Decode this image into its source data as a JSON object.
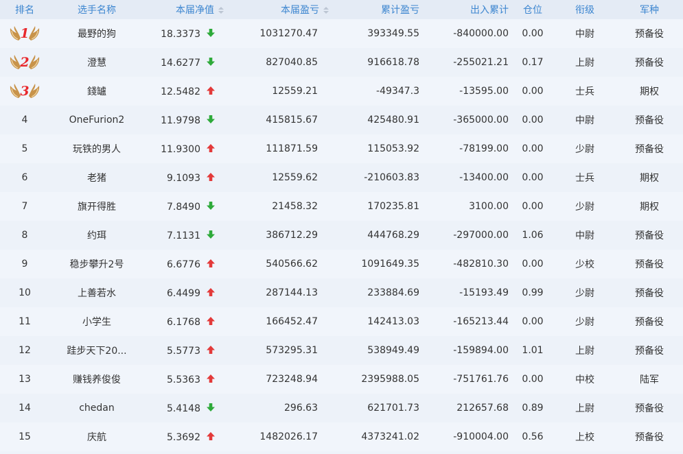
{
  "headers": {
    "rank": "排名",
    "name": "选手名称",
    "nav": "本届净值",
    "profit": "本届盈亏",
    "total": "累计盈亏",
    "flow": "出入累计",
    "position": "仓位",
    "title": "衔级",
    "branch": "军种"
  },
  "colors": {
    "header_text": "#3d86d0",
    "up": "#e33a3a",
    "down": "#2eaa3a",
    "medal_number": "#e8282c"
  },
  "rows": [
    {
      "rank": "1",
      "name": "最野的狗",
      "nav": "18.3373",
      "trend": "down",
      "profit": "1031270.47",
      "total": "393349.55",
      "flow": "-840000.00",
      "pos": "0.00",
      "title": "中尉",
      "branch": "预备役"
    },
    {
      "rank": "2",
      "name": "澄慧",
      "nav": "14.6277",
      "trend": "down",
      "profit": "827040.85",
      "total": "916618.78",
      "flow": "-255021.21",
      "pos": "0.17",
      "title": "上尉",
      "branch": "预备役"
    },
    {
      "rank": "3",
      "name": "錢罏",
      "nav": "12.5482",
      "trend": "up",
      "profit": "12559.21",
      "total": "-49347.3",
      "flow": "-13595.00",
      "pos": "0.00",
      "title": "士兵",
      "branch": "期权"
    },
    {
      "rank": "4",
      "name": "OneFurion2",
      "nav": "11.9798",
      "trend": "down",
      "profit": "415815.67",
      "total": "425480.91",
      "flow": "-365000.00",
      "pos": "0.00",
      "title": "中尉",
      "branch": "预备役"
    },
    {
      "rank": "5",
      "name": "玩铁的男人",
      "nav": "11.9300",
      "trend": "up",
      "profit": "111871.59",
      "total": "115053.92",
      "flow": "-78199.00",
      "pos": "0.00",
      "title": "少尉",
      "branch": "预备役"
    },
    {
      "rank": "6",
      "name": "老猪",
      "nav": "9.1093",
      "trend": "up",
      "profit": "12559.62",
      "total": "-210603.83",
      "flow": "-13400.00",
      "pos": "0.00",
      "title": "士兵",
      "branch": "期权"
    },
    {
      "rank": "7",
      "name": "旗开得胜",
      "nav": "7.8490",
      "trend": "down",
      "profit": "21458.32",
      "total": "170235.81",
      "flow": "3100.00",
      "pos": "0.00",
      "title": "少尉",
      "branch": "期权"
    },
    {
      "rank": "8",
      "name": "约珥",
      "nav": "7.1131",
      "trend": "down",
      "profit": "386712.29",
      "total": "444768.29",
      "flow": "-297000.00",
      "pos": "1.06",
      "title": "中尉",
      "branch": "预备役"
    },
    {
      "rank": "9",
      "name": "稳步攀升2号",
      "nav": "6.6776",
      "trend": "up",
      "profit": "540566.62",
      "total": "1091649.35",
      "flow": "-482810.30",
      "pos": "0.00",
      "title": "少校",
      "branch": "预备役"
    },
    {
      "rank": "10",
      "name": "上善若水",
      "nav": "6.4499",
      "trend": "up",
      "profit": "287144.13",
      "total": "233884.69",
      "flow": "-15193.49",
      "pos": "0.99",
      "title": "少尉",
      "branch": "预备役"
    },
    {
      "rank": "11",
      "name": "小学生",
      "nav": "6.1768",
      "trend": "up",
      "profit": "166452.47",
      "total": "142413.03",
      "flow": "-165213.44",
      "pos": "0.00",
      "title": "少尉",
      "branch": "预备役"
    },
    {
      "rank": "12",
      "name": "跬步天下20...",
      "nav": "5.5773",
      "trend": "up",
      "profit": "573295.31",
      "total": "538949.49",
      "flow": "-159894.00",
      "pos": "1.01",
      "title": "上尉",
      "branch": "预备役"
    },
    {
      "rank": "13",
      "name": "赚钱养俊俊",
      "nav": "5.5363",
      "trend": "up",
      "profit": "723248.94",
      "total": "2395988.05",
      "flow": "-751761.76",
      "pos": "0.00",
      "title": "中校",
      "branch": "陆军"
    },
    {
      "rank": "14",
      "name": "chedan",
      "nav": "5.4148",
      "trend": "down",
      "profit": "296.63",
      "total": "621701.73",
      "flow": "212657.68",
      "pos": "0.89",
      "title": "上尉",
      "branch": "预备役"
    },
    {
      "rank": "15",
      "name": "庆航",
      "nav": "5.3692",
      "trend": "up",
      "profit": "1482026.17",
      "total": "4373241.02",
      "flow": "-910004.00",
      "pos": "0.56",
      "title": "上校",
      "branch": "预备役"
    }
  ]
}
